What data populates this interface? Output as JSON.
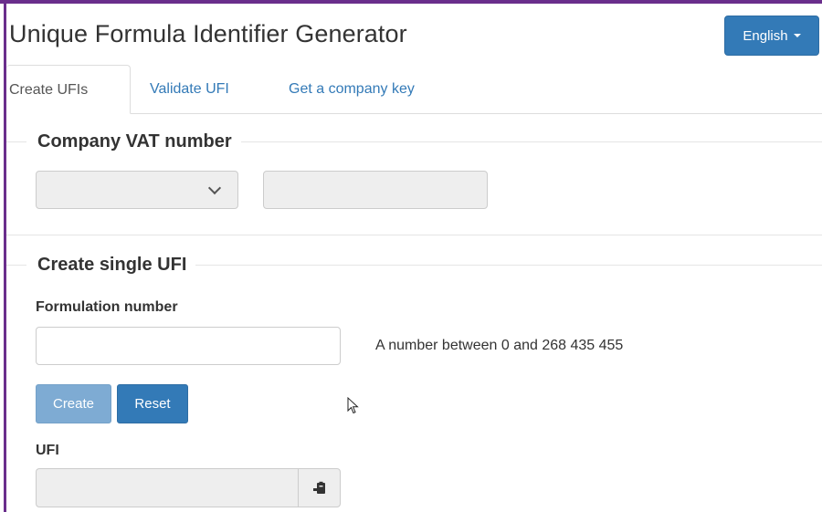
{
  "app": {
    "title": "Unique Formula Identifier Generator",
    "language_label": "English"
  },
  "tabs": [
    {
      "label": "Create UFIs",
      "active": true
    },
    {
      "label": "Validate UFI",
      "active": false
    },
    {
      "label": "Get a company key",
      "active": false
    }
  ],
  "vat_section": {
    "legend": "Company VAT number",
    "country_select_value": "",
    "vat_value": ""
  },
  "single_section": {
    "legend": "Create single UFI",
    "formulation_label": "Formulation number",
    "formulation_value": "",
    "formulation_help": "A number between 0 and 268 435 455",
    "create_label": "Create",
    "reset_label": "Reset",
    "ufi_label": "UFI",
    "ufi_value": ""
  },
  "colors": {
    "accent": "#337ab7",
    "accent_disabled": "#7eabd3",
    "window_border": "#6a2e8c"
  },
  "icons": {
    "copy": "paste-clipboard-icon",
    "dropdown": "chevron-down-icon",
    "language_caret": "caret-down-icon",
    "cursor": "mouse-pointer-icon"
  }
}
